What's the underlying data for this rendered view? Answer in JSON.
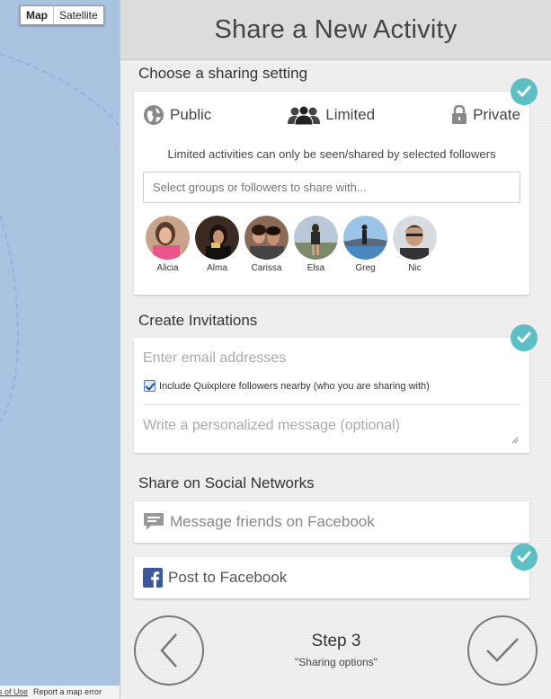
{
  "map": {
    "toggle": {
      "map_label": "Map",
      "satellite_label": "Satellite"
    },
    "footer": {
      "terms": "ns of Use",
      "report": "Report a map error"
    }
  },
  "panel": {
    "title": "Share a New Activity",
    "sharing": {
      "heading": "Choose a sharing setting",
      "options": {
        "public": "Public",
        "limited": "Limited",
        "private": "Private"
      },
      "selected": "Limited",
      "description": "Limited activities can only be seen/shared by selected followers",
      "search_placeholder": "Select groups or followers to share with...",
      "people": [
        {
          "name": "Alicia"
        },
        {
          "name": "Alma"
        },
        {
          "name": "Carissa"
        },
        {
          "name": "Elsa"
        },
        {
          "name": "Greg"
        },
        {
          "name": "Nic"
        }
      ]
    },
    "invitations": {
      "heading": "Create Invitations",
      "email_placeholder": "Enter email addresses",
      "include_followers_label": "Include Quixplore followers nearby (who you are sharing with)",
      "include_followers_checked": true,
      "message_placeholder": "Write a personalized message (optional)"
    },
    "social": {
      "heading": "Share on Social Networks",
      "message_friends": "Message friends on Facebook",
      "post_facebook": "Post to Facebook"
    },
    "footer": {
      "step": "Step 3",
      "step_name": "\"Sharing options\""
    }
  },
  "colors": {
    "accent_check": "#5cbfc6",
    "map_water": "#a9c3e0",
    "facebook": "#3b5998"
  }
}
